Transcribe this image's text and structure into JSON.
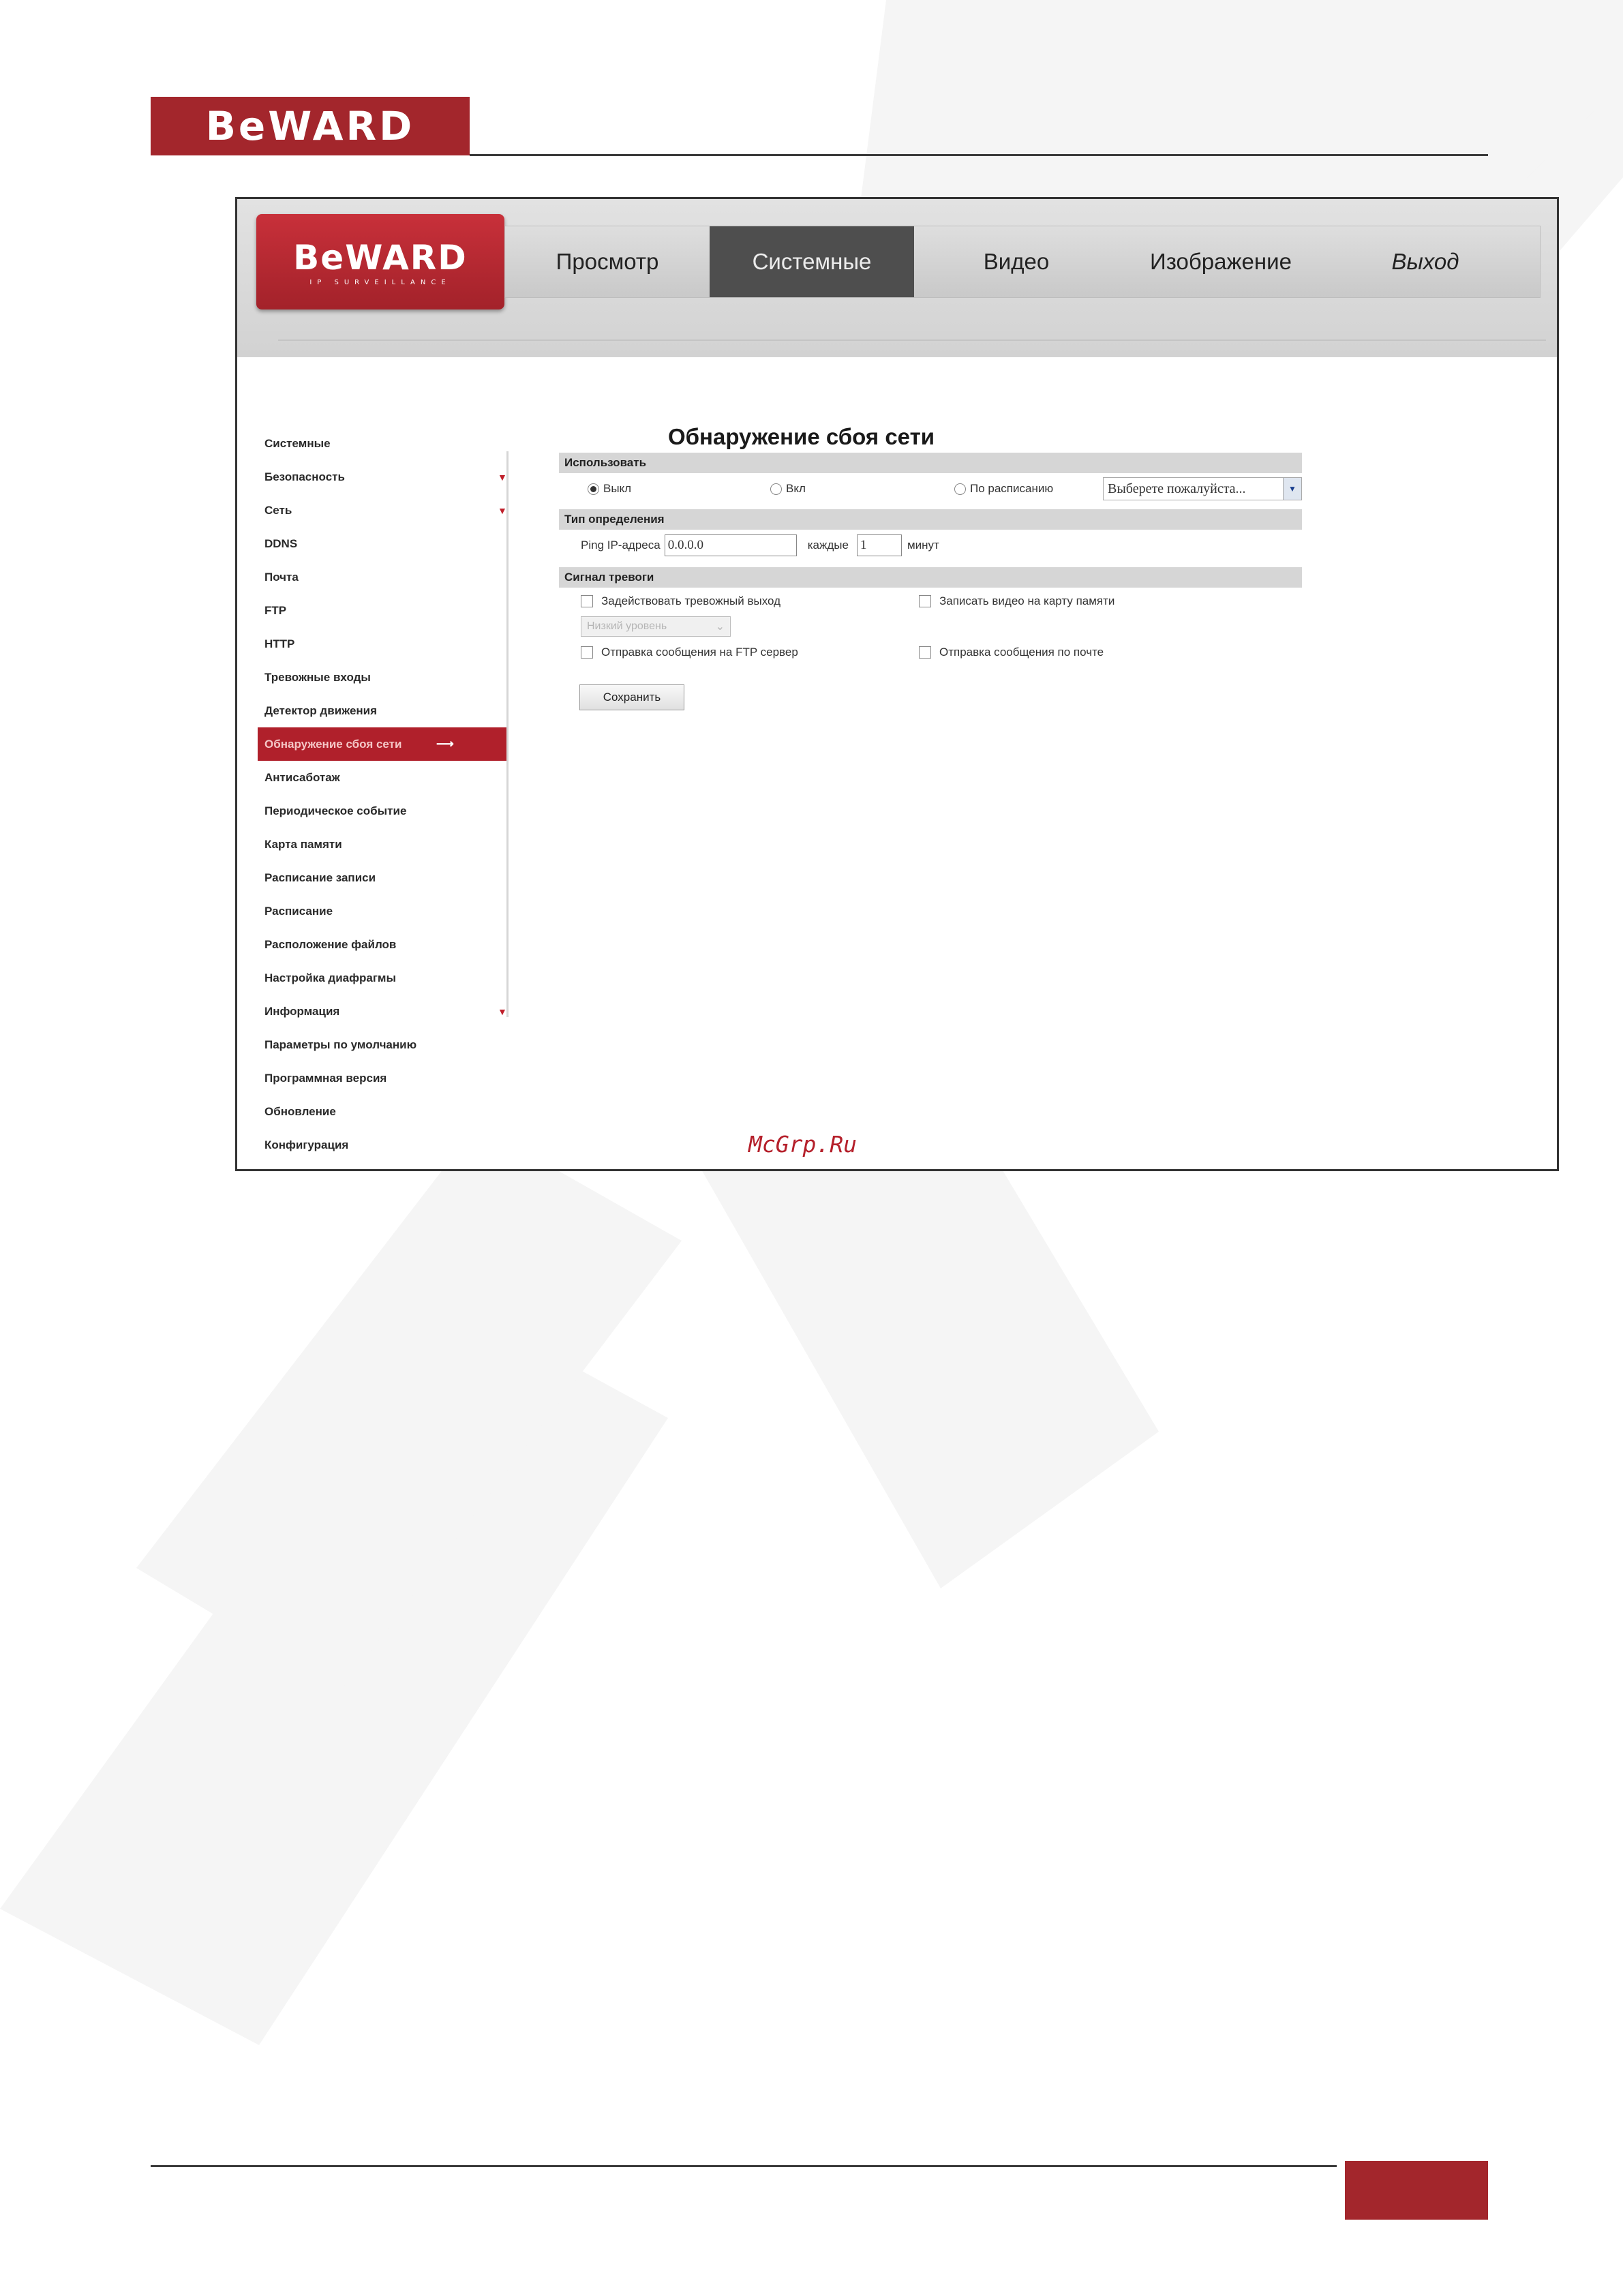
{
  "document": {
    "brand": "BeWARD"
  },
  "screenshot": {
    "logo": {
      "brand": "BeWARD",
      "tagline": "IP SURVEILLANCE"
    },
    "nav_tabs": [
      {
        "label": "Просмотр"
      },
      {
        "label": "Системные"
      },
      {
        "label": "Видео"
      },
      {
        "label": "Изображение"
      },
      {
        "label": "Выход"
      }
    ],
    "sidebar": [
      "Системные",
      "Безопасность",
      "Сеть",
      "DDNS",
      "Почта",
      "FTP",
      "HTTP",
      "Тревожные входы",
      "Детектор движения",
      "Обнаружение сбоя сети",
      "Антисаботаж",
      "Периодическое событие",
      "Карта памяти",
      "Расписание записи",
      "Расписание",
      "Расположение файлов",
      "Настройка диафрагмы",
      "Информация",
      "Параметры по умолчанию",
      "Программная версия",
      "Обновление",
      "Конфигурация"
    ],
    "page_title": "Обнаружение сбоя сети",
    "sections": {
      "use": {
        "title": "Использовать",
        "opt_off": "Выкл",
        "opt_on": "Вкл",
        "opt_schedule": "По расписанию",
        "schedule_select": "Выберете пожалуйста..."
      },
      "detection": {
        "title": "Тип определения",
        "ping_label": "Ping IP-адреса",
        "ip_value": "0.0.0.0",
        "every_label": "каждые",
        "minutes_value": "1",
        "minutes_label": "минут"
      },
      "alarm": {
        "title": "Сигнал тревоги",
        "alarm_out": "Задействовать тревожный выход",
        "level_select": "Низкий уровень",
        "record_sd": "Записать видео на карту памяти",
        "ftp_msg": "Отправка сообщения на FTP сервер",
        "email_msg": "Отправка сообщения по почте"
      }
    },
    "save_button": "Сохранить",
    "source_mark": "McGrp.Ru"
  }
}
